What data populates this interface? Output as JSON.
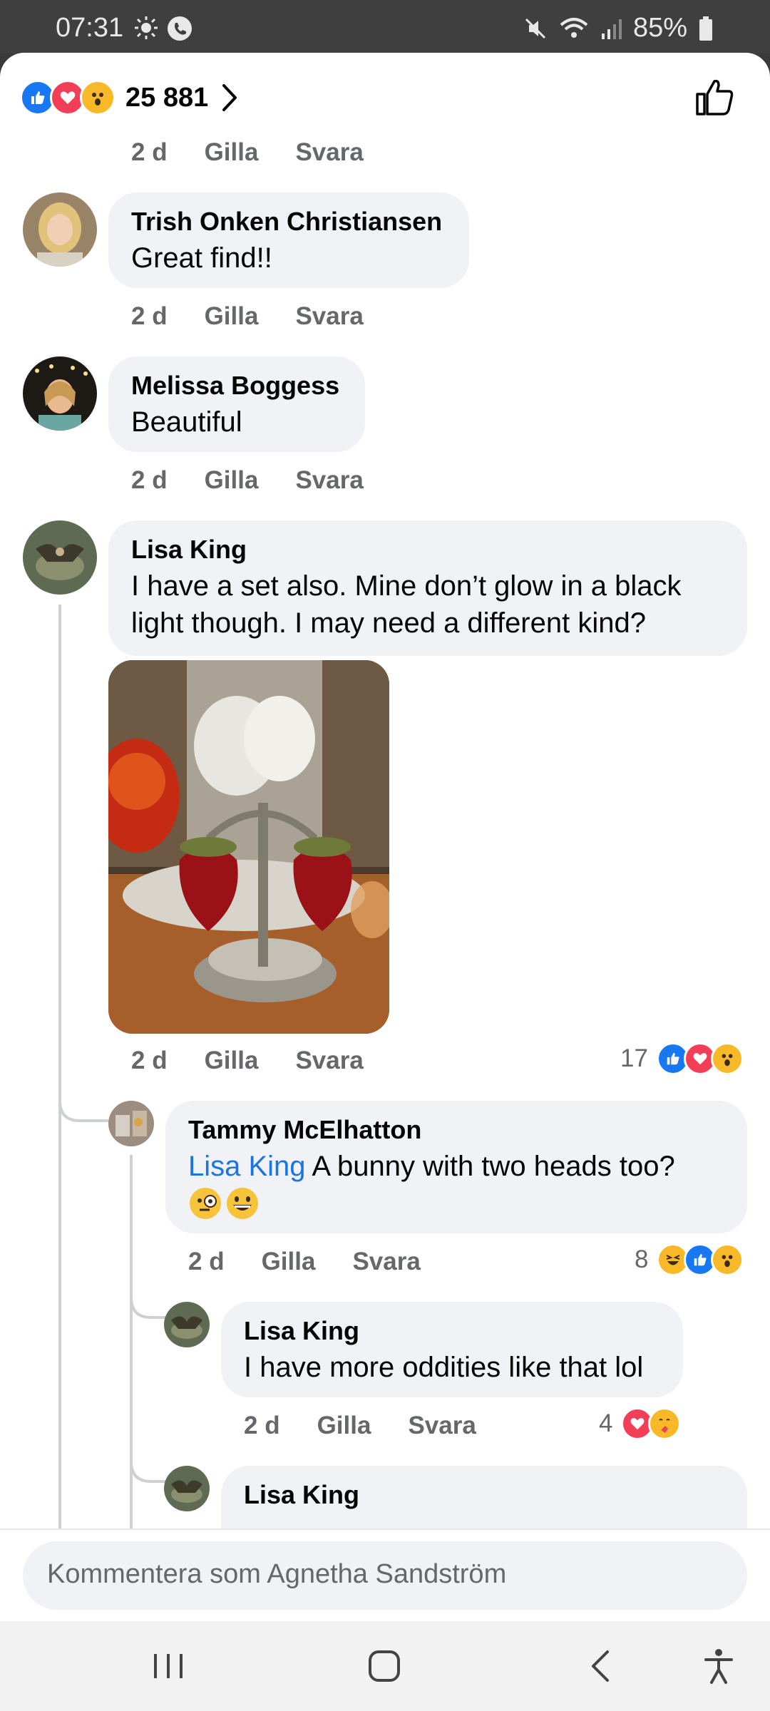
{
  "status": {
    "time": "07:31",
    "battery": "85%"
  },
  "header": {
    "reaction_count": "25 881"
  },
  "top_meta": {
    "time": "2 d",
    "like": "Gilla",
    "reply": "Svara"
  },
  "comments": [
    {
      "name": "Trish Onken Christiansen",
      "text": "Great find!!",
      "time": "2 d",
      "like": "Gilla",
      "reply": "Svara"
    },
    {
      "name": "Melissa Boggess",
      "text": "Beautiful",
      "time": "2 d",
      "like": "Gilla",
      "reply": "Svara"
    },
    {
      "name": "Lisa King",
      "text_line1": "I have a set also. Mine don’t glow in a black",
      "text_line2": "light though. I may need a different kind?",
      "time": "2 d",
      "like": "Gilla",
      "reply": "Svara",
      "reaction_count": "17"
    },
    {
      "name": "Tammy McElhatton",
      "mention": "Lisa King",
      "text": " A bunny with two heads too?",
      "time": "2 d",
      "like": "Gilla",
      "reply": "Svara",
      "reaction_count": "8"
    },
    {
      "name": "Lisa King",
      "text": "I have more oddities like that lol",
      "time": "2 d",
      "like": "Gilla",
      "reply": "Svara",
      "reaction_count": "4"
    },
    {
      "name": "Lisa King"
    }
  ],
  "composer": {
    "placeholder": "Kommentera som Agnetha Sandström"
  },
  "colors": {
    "like_blue": "#1877f2",
    "love_red": "#f33e58",
    "wow_yellow": "#f7b928",
    "link_blue": "#1b74e4"
  }
}
